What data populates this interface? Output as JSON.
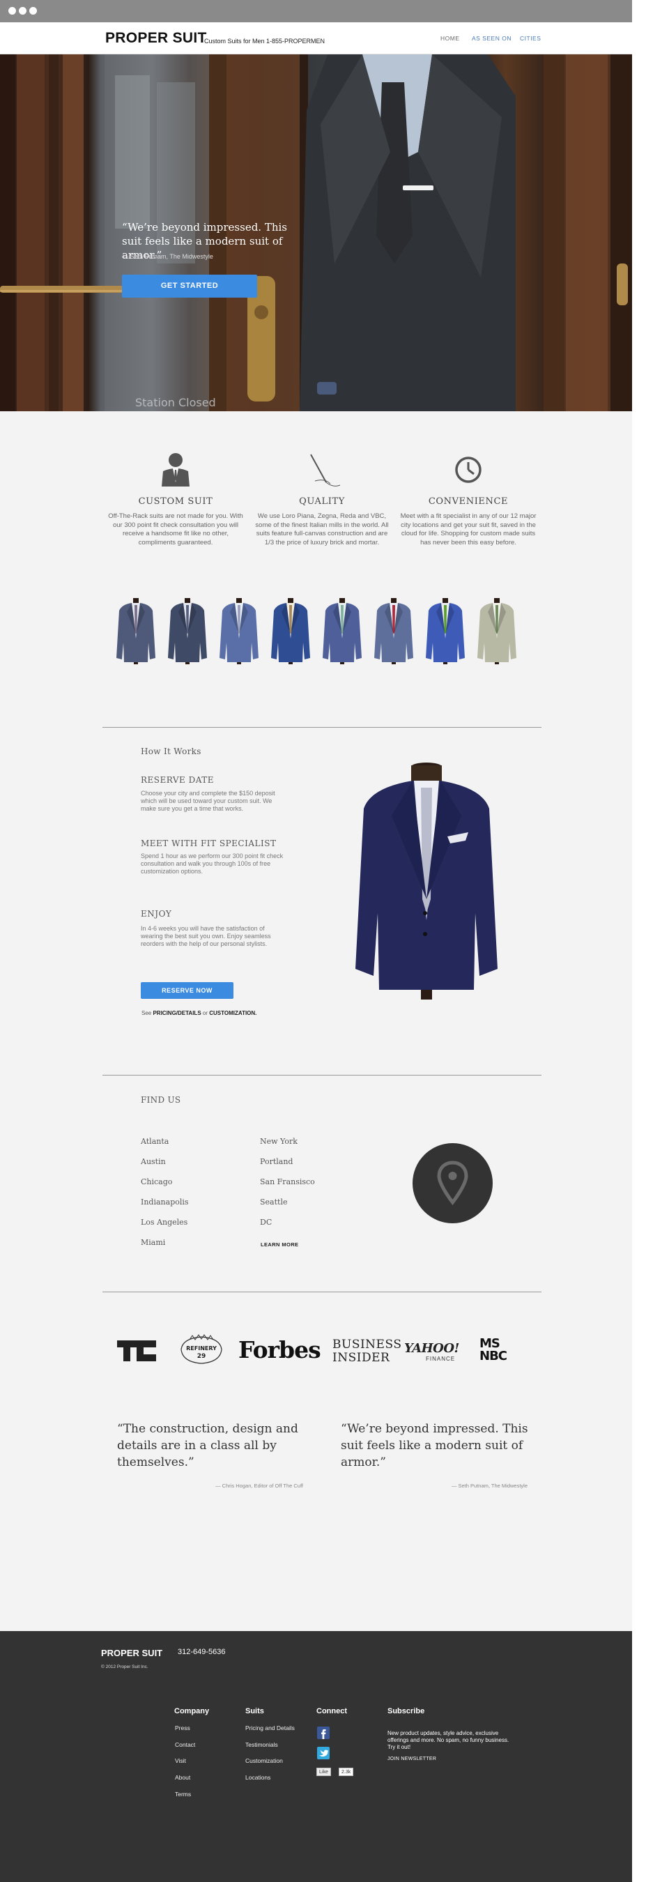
{
  "header": {
    "logo": "PROPER SUIT",
    "tagline": "Custom Suits for Men 1-855-PROPERMEN",
    "nav": [
      "HOME",
      "AS SEEN ON",
      "CITIES"
    ]
  },
  "hero": {
    "quote": "“We’re beyond impressed. This suit feels like a modern suit of armor.”",
    "cite": "— Seth Putnam, The Midwestyle",
    "cta": "GET STARTED",
    "sign_text": "Station Closed"
  },
  "features": [
    {
      "icon": "suited-man-icon",
      "title": "CUSTOM SUIT",
      "text": "Off-The-Rack suits are not made for you. With our 300 point fit check consultation you will receive a handsome fit like no other, compliments guaranteed."
    },
    {
      "icon": "needle-thread-icon",
      "title": "QUALITY",
      "text": "We  use Loro Piana, Zegna, Reda and VBC, some of the finest Italian mills in the world. All suits feature full-canvas construction and are 1/3 the price of luxury brick and mortar."
    },
    {
      "icon": "clock-icon",
      "title": "CONVENIENCE",
      "text": "Meet with a fit specialist in any of our 12 major city locations and get your suit fit, saved in the cloud for life. Shopping for custom made suits has never been this easy before."
    }
  ],
  "suit_colors": [
    {
      "jacket": "#4f5a7a",
      "tie": "#7a6f8a",
      "shirt": "#e8e8f0"
    },
    {
      "jacket": "#3f4a66",
      "tie": "#556080",
      "shirt": "#e6e6ee"
    },
    {
      "jacket": "#5a6fa8",
      "tie": "#9aa0c0",
      "shirt": "#eef0f8"
    },
    {
      "jacket": "#2f4d93",
      "tie": "#a88a5a",
      "shirt": "#f0ece0"
    },
    {
      "jacket": "#4e5f9a",
      "tie": "#7fb0a0",
      "shirt": "#e8f0ee"
    },
    {
      "jacket": "#5e6f9c",
      "tie": "#b02a3a",
      "shirt": "#eef0f6"
    },
    {
      "jacket": "#3e5bb8",
      "tie": "#5aa02a",
      "shirt": "#eaeaf0"
    },
    {
      "jacket": "#b7b9a5",
      "tie": "#6a8a5a",
      "shirt": "#f2f2ea"
    }
  ],
  "how": {
    "heading": "How It Works",
    "steps": [
      {
        "title": "RESERVE DATE",
        "text": "Choose your city and complete the $150 deposit which will be used toward your custom suit. We make sure you get a time that works."
      },
      {
        "title": "MEET WITH FIT SPECIALIST",
        "text": "Spend 1 hour as we perform our 300 point fit check consultation and walk you through 100s of free customization options."
      },
      {
        "title": "ENJOY",
        "text": "In 4-6 weeks you will have the satisfaction of wearing the best suit you own. Enjoy seamless reorders with the help of our personal stylists."
      }
    ],
    "cta": "RESERVE NOW",
    "see_prefix": "See",
    "see_link1": "PRICING/DETAILS",
    "see_or": "or",
    "see_link2": "CUSTOMIZATION."
  },
  "find_us": {
    "heading": "FIND US",
    "col1": [
      "Atlanta",
      "Austin",
      "Chicago",
      "Indianapolis",
      "Los Angeles",
      "Miami"
    ],
    "col2": [
      "New York",
      "Portland",
      "San Fransisco",
      "Seattle",
      "DC"
    ],
    "learn_more": "LEARN MORE"
  },
  "press": {
    "tc": "TC",
    "refinery": "REFINERY",
    "refinery_num": "29",
    "forbes": "Forbes",
    "bi_line1": "BUSINESS",
    "bi_line2": "INSIDER",
    "yahoo": "YAHOO!",
    "yahoo_sub": "FINANCE",
    "msnbc_line1": "MS",
    "msnbc_line2": "NBC"
  },
  "testimonials": [
    {
      "quote": "“The construction, design and details are in a class all by themselves.”",
      "cite": "— Chris Hogan, Editor of Off The Cuff"
    },
    {
      "quote": "“We’re beyond impressed. This suit feels like a modern suit of armor.”",
      "cite": "— Seth Putnam, The Midwestyle"
    }
  ],
  "footer": {
    "logo": "PROPER SUIT",
    "phone": "312-649-5636",
    "copyright": "© 2012 Proper Suit Inc.",
    "company": {
      "heading": "Company",
      "links": [
        "Press",
        "Contact",
        "Visit",
        "About",
        "Terms"
      ]
    },
    "suits": {
      "heading": "Suits",
      "links": [
        "Pricing and Details",
        "Testimonials",
        "Customization",
        "Locations"
      ]
    },
    "connect": {
      "heading": "Connect",
      "like": "Like",
      "like_count": "2.3k"
    },
    "subscribe": {
      "heading": "Subscribe",
      "text": "New product updates, style advice, exclusive offerings and more. No spam, no funny business. Try it out!",
      "join": "JOIN NEWSLETTER"
    }
  },
  "colors": {
    "accent": "#3b8be0",
    "footer_bg": "#333333",
    "page_bg": "#f3f3f3"
  }
}
